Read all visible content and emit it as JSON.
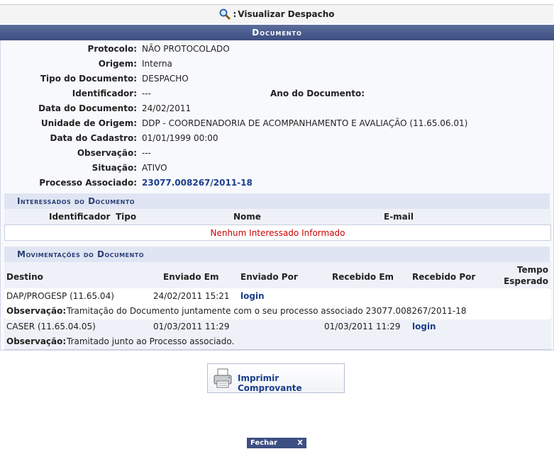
{
  "page_title": "Visualizar Despacho",
  "section_title": "Documento",
  "fields": [
    {
      "label": "Protocolo:",
      "value": "NÃO PROTOCOLADO"
    },
    {
      "label": "Origem:",
      "value": "Interna"
    },
    {
      "label": "Tipo do Documento:",
      "value": "DESPACHO"
    },
    {
      "label": "Identificador:",
      "value": "---"
    },
    {
      "label": "Data do Documento:",
      "value": "24/02/2011"
    },
    {
      "label": "Unidade de Origem:",
      "value": "DDP - COORDENADORIA DE ACOMPANHAMENTO E AVALIAÇÃO (11.65.06.01)"
    },
    {
      "label": "Data do Cadastro:",
      "value": "01/01/1999 00:00"
    },
    {
      "label": "Observação:",
      "value": "---"
    },
    {
      "label": "Situação:",
      "value": "ATIVO"
    },
    {
      "label": "Processo Associado:",
      "value": "23077.008267/2011-18"
    }
  ],
  "ano_documento_label": "Ano do Documento:",
  "interessados": {
    "title": "Interessados do Documento",
    "columns": [
      "Identificador",
      "Tipo",
      "Nome",
      "E-mail"
    ],
    "empty_message": "Nenhum Interessado Informado"
  },
  "movimentacoes": {
    "title": "Movimentações do Documento",
    "columns": [
      "Destino",
      "Enviado Em",
      "Enviado Por",
      "Recebido Em",
      "Recebido Por",
      "Tempo",
      "Esperado"
    ],
    "observacao_label": "Observação:",
    "rows": [
      {
        "destino": "DAP/PROGESP (11.65.04)",
        "enviado_em": "24/02/2011 15:21",
        "enviado_por": "login",
        "recebido_em": "",
        "recebido_por": "",
        "observacao": "Tramitação do Documento juntamente com o seu processo associado 23077.008267/2011-18"
      },
      {
        "destino": "CASER (11.65.04.05)",
        "enviado_em": "01/03/2011 11:29",
        "enviado_por": "",
        "recebido_em": "01/03/2011 11:29",
        "recebido_por": "login",
        "observacao": "Tramitado junto ao Processo associado."
      }
    ]
  },
  "print_button_label": "Imprimir Comprovante",
  "close_button_label": "Fechar",
  "close_button_x": "X",
  "colors": {
    "header": "#3d4f82",
    "link": "#1a3e8c",
    "empty_message": "#cc0000"
  }
}
